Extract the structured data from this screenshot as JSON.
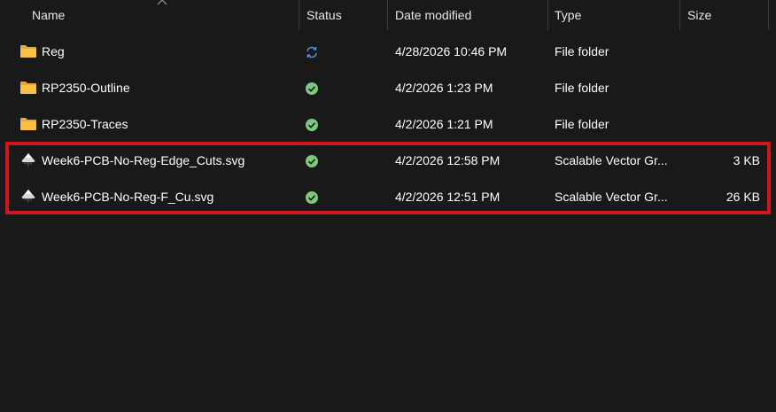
{
  "columns": {
    "name": "Name",
    "status": "Status",
    "date_modified": "Date modified",
    "type": "Type",
    "size": "Size"
  },
  "sort": {
    "column": "name",
    "icon": "chevron-up-icon"
  },
  "colors": {
    "background": "#191919",
    "folder": "#f8c146",
    "synced_green": "#7ec87e",
    "syncing_blue": "#4a9fe0",
    "highlight": "#d0161c"
  },
  "files": [
    {
      "name": "Reg",
      "status": "syncing",
      "status_icon": "sync-icon",
      "date": "4/28/2026 10:46 PM",
      "type": "File folder",
      "size": "",
      "icon": "folder-icon"
    },
    {
      "name": "RP2350-Outline",
      "status": "available",
      "status_icon": "check-circle-icon",
      "date": "4/2/2026 1:23 PM",
      "type": "File folder",
      "size": "",
      "icon": "folder-icon"
    },
    {
      "name": "RP2350-Traces",
      "status": "available",
      "status_icon": "check-circle-icon",
      "date": "4/2/2026 1:21 PM",
      "type": "File folder",
      "size": "",
      "icon": "folder-icon"
    },
    {
      "name": "Week6-PCB-No-Reg-Edge_Cuts.svg",
      "status": "available",
      "status_icon": "check-circle-icon",
      "date": "4/2/2026 12:58 PM",
      "type": "Scalable Vector Gr...",
      "size": "3 KB",
      "icon": "inkscape-svg-icon"
    },
    {
      "name": "Week6-PCB-No-Reg-F_Cu.svg",
      "status": "available",
      "status_icon": "check-circle-icon",
      "date": "4/2/2026 12:51 PM",
      "type": "Scalable Vector Gr...",
      "size": "26 KB",
      "icon": "inkscape-svg-icon"
    }
  ]
}
